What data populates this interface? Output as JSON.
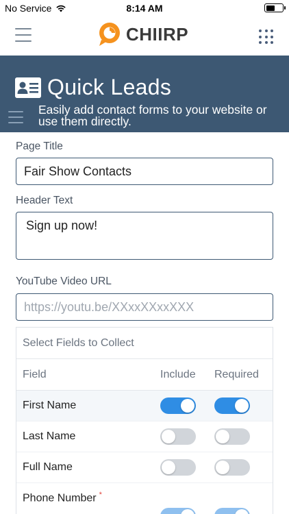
{
  "status_bar": {
    "carrier": "No Service",
    "time": "8:14 AM",
    "battery_level": 0.55
  },
  "header": {
    "logo_text": "CHIIRP",
    "brand_color": "#f5921e",
    "menu_icon": "hamburger-icon",
    "apps_icon": "grid-dots-icon"
  },
  "banner": {
    "icon": "contact-card-icon",
    "title": "Quick Leads",
    "subtitle": "Easily add contact forms to your website or use them directly.",
    "background_color": "#3d5873"
  },
  "form": {
    "page_title_label": "Page Title",
    "page_title_value": "Fair Show Contacts",
    "header_text_label": "Header Text",
    "header_text_value": "Sign up now!",
    "youtube_label": "YouTube Video URL",
    "youtube_placeholder": "https://youtu.be/XXxxXXxxXXX"
  },
  "fields_table": {
    "caption": "Select Fields to Collect",
    "headers": {
      "field": "Field",
      "include": "Include",
      "required": "Required"
    },
    "rows": [
      {
        "name": "First Name",
        "include": true,
        "required": true,
        "required_mark": false
      },
      {
        "name": "Last Name",
        "include": false,
        "required": false,
        "required_mark": false
      },
      {
        "name": "Full Name",
        "include": false,
        "required": false,
        "required_mark": false
      },
      {
        "name": "Phone Number",
        "include": true,
        "required": true,
        "required_mark": true,
        "required_mark_text": "*"
      }
    ],
    "toggle_on_color": "#2f8de4",
    "toggle_off_color": "#d1d5da"
  }
}
